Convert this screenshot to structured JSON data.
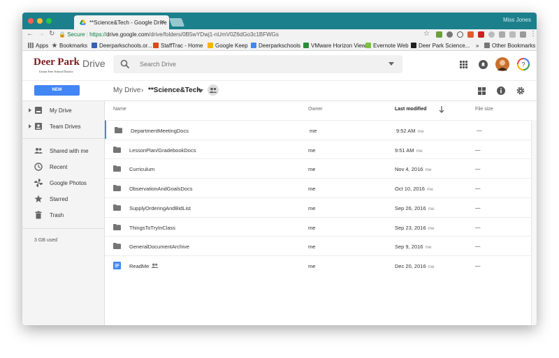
{
  "browser": {
    "tab_title": "**Science&Tech - Google Drive",
    "user_label": "Miss Jones",
    "secure_label": "Secure",
    "url_prefix": "https://",
    "url_host": "drive.google.com",
    "url_path": "/drive/folders/0B5wYDwj1-nUmV0Z6dGo3c1BFWGs",
    "colors": {
      "titlebar": "#1c7f8c",
      "close": "#ff5f57",
      "minimize": "#febc2e",
      "maximize": "#28c840"
    }
  },
  "bookmarks": {
    "apps": "Apps",
    "items": [
      "Bookmarks",
      "Deerparkschools.or...",
      "StaffTrac - Home",
      "Google Keep",
      "Deerparkschools",
      "VMware Horizon View",
      "Evernote Web",
      "Deer Park Science..."
    ],
    "overflow": "»",
    "other": "Other Bookmarks"
  },
  "header": {
    "logo_title": "Deer Park",
    "logo_subtitle": "Union Free School District",
    "product": "Drive",
    "search_placeholder": "Search Drive",
    "help_glyph": "?"
  },
  "subheader": {
    "new_label": "NEW",
    "breadcrumb_root": "My Drive",
    "breadcrumb_sep": "›",
    "breadcrumb_current": "**Science&Tech"
  },
  "sidebar": {
    "items": [
      {
        "label": "My Drive",
        "icon": "my-drive-icon"
      },
      {
        "label": "Team Drives",
        "icon": "team-drives-icon"
      },
      {
        "label": "Shared with me",
        "icon": "shared-icon"
      },
      {
        "label": "Recent",
        "icon": "clock-icon"
      },
      {
        "label": "Google Photos",
        "icon": "photos-icon"
      },
      {
        "label": "Starred",
        "icon": "star-icon"
      },
      {
        "label": "Trash",
        "icon": "trash-icon"
      }
    ],
    "storage": "3 GB used"
  },
  "list": {
    "columns": {
      "name": "Name",
      "owner": "Owner",
      "modified": "Last modified",
      "size": "File size"
    },
    "rows": [
      {
        "name": "DepartmentMeetingDocs",
        "owner": "me",
        "modified": "9:52 AM",
        "by": "me",
        "size": "—",
        "type": "folder"
      },
      {
        "name": "LessonPlan/GradebookDocs",
        "owner": "me",
        "modified": "9:51 AM",
        "by": "me",
        "size": "—",
        "type": "folder"
      },
      {
        "name": "Curriculum",
        "owner": "me",
        "modified": "Nov 4, 2016",
        "by": "me",
        "size": "—",
        "type": "folder"
      },
      {
        "name": "ObservationAndGoalsDocs",
        "owner": "me",
        "modified": "Oct 10, 2016",
        "by": "me",
        "size": "—",
        "type": "folder"
      },
      {
        "name": "SupplyOrderingAndBidList",
        "owner": "me",
        "modified": "Sep 26, 2016",
        "by": "me",
        "size": "—",
        "type": "folder"
      },
      {
        "name": "ThingsToTryInClass",
        "owner": "me",
        "modified": "Sep 23, 2016",
        "by": "me",
        "size": "—",
        "type": "folder"
      },
      {
        "name": "GeneralDocumentArchive",
        "owner": "me",
        "modified": "Sep 9, 2016",
        "by": "me",
        "size": "—",
        "type": "folder"
      },
      {
        "name": "ReadMe",
        "owner": "me",
        "modified": "Dec 20, 2016",
        "by": "me",
        "size": "—",
        "type": "doc"
      }
    ]
  }
}
